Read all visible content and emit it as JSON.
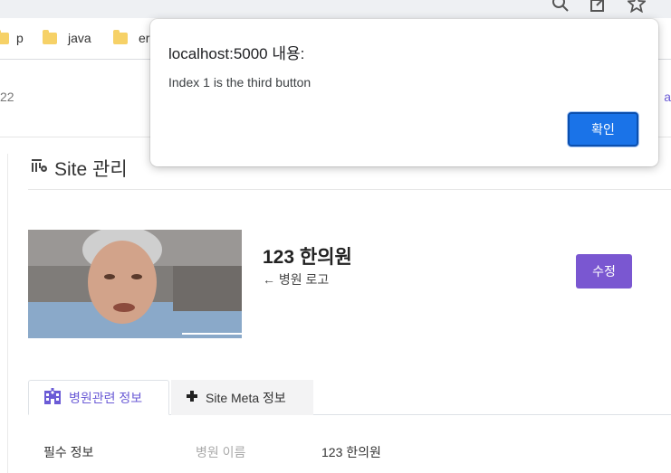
{
  "browser": {
    "bookmarks": [
      {
        "label": "p"
      },
      {
        "label": "java"
      },
      {
        "label": "er"
      }
    ],
    "icons": [
      "zoom-icon",
      "share-icon",
      "star-icon"
    ]
  },
  "page": {
    "left_fragment": "22",
    "right_fragment": "a",
    "section_title": "Site 관리",
    "clinic_name": "123 한의원",
    "logo_caption": "← 병원 로고",
    "edit_label": "수정",
    "tabs": [
      {
        "label": "병원관련 정보"
      },
      {
        "label": "Site Meta 정보"
      }
    ],
    "info_row": {
      "section": "필수 정보",
      "field_label": "병원 이름",
      "field_value": "123 한의원"
    }
  },
  "dialog": {
    "title": "localhost:5000 내용:",
    "message": "Index 1 is the third button",
    "ok_label": "확인"
  },
  "colors": {
    "accent_purple": "#7a57d1",
    "dialog_blue": "#1a73e8"
  }
}
